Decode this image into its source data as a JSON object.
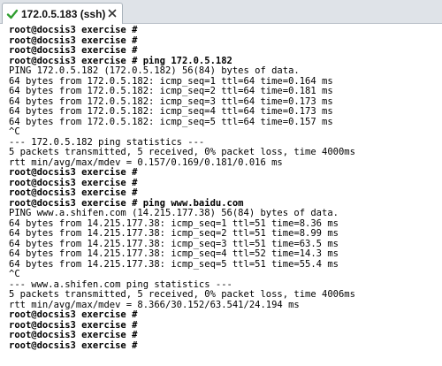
{
  "tab": {
    "title": "172.0.5.183 (ssh)",
    "status_color": "#2f9e2f"
  },
  "terminal": {
    "lines": [
      {
        "type": "prompt",
        "text": "root@docsis3 exercise #"
      },
      {
        "type": "prompt",
        "text": "root@docsis3 exercise #"
      },
      {
        "type": "prompt",
        "text": "root@docsis3 exercise #"
      },
      {
        "type": "prompt",
        "text": "root@docsis3 exercise # ping 172.0.5.182"
      },
      {
        "type": "output",
        "text": "PING 172.0.5.182 (172.0.5.182) 56(84) bytes of data."
      },
      {
        "type": "output",
        "text": "64 bytes from 172.0.5.182: icmp_seq=1 ttl=64 time=0.164 ms"
      },
      {
        "type": "output",
        "text": "64 bytes from 172.0.5.182: icmp_seq=2 ttl=64 time=0.181 ms"
      },
      {
        "type": "output",
        "text": "64 bytes from 172.0.5.182: icmp_seq=3 ttl=64 time=0.173 ms"
      },
      {
        "type": "output",
        "text": "64 bytes from 172.0.5.182: icmp_seq=4 ttl=64 time=0.173 ms"
      },
      {
        "type": "output",
        "text": "64 bytes from 172.0.5.182: icmp_seq=5 ttl=64 time=0.157 ms"
      },
      {
        "type": "output",
        "text": "^C"
      },
      {
        "type": "output",
        "text": "--- 172.0.5.182 ping statistics ---"
      },
      {
        "type": "output",
        "text": "5 packets transmitted, 5 received, 0% packet loss, time 4000ms"
      },
      {
        "type": "output",
        "text": "rtt min/avg/max/mdev = 0.157/0.169/0.181/0.016 ms"
      },
      {
        "type": "prompt",
        "text": "root@docsis3 exercise #"
      },
      {
        "type": "prompt",
        "text": "root@docsis3 exercise #"
      },
      {
        "type": "prompt",
        "text": "root@docsis3 exercise #"
      },
      {
        "type": "prompt",
        "text": "root@docsis3 exercise # ping www.baidu.com"
      },
      {
        "type": "output",
        "text": "PING www.a.shifen.com (14.215.177.38) 56(84) bytes of data."
      },
      {
        "type": "output",
        "text": "64 bytes from 14.215.177.38: icmp_seq=1 ttl=51 time=8.36 ms"
      },
      {
        "type": "output",
        "text": "64 bytes from 14.215.177.38: icmp_seq=2 ttl=51 time=8.99 ms"
      },
      {
        "type": "output",
        "text": "64 bytes from 14.215.177.38: icmp_seq=3 ttl=51 time=63.5 ms"
      },
      {
        "type": "output",
        "text": "64 bytes from 14.215.177.38: icmp_seq=4 ttl=52 time=14.3 ms"
      },
      {
        "type": "output",
        "text": "64 bytes from 14.215.177.38: icmp_seq=5 ttl=51 time=55.4 ms"
      },
      {
        "type": "output",
        "text": "^C"
      },
      {
        "type": "output",
        "text": "--- www.a.shifen.com ping statistics ---"
      },
      {
        "type": "output",
        "text": "5 packets transmitted, 5 received, 0% packet loss, time 4006ms"
      },
      {
        "type": "output",
        "text": "rtt min/avg/max/mdev = 8.366/30.152/63.541/24.194 ms"
      },
      {
        "type": "prompt",
        "text": "root@docsis3 exercise #"
      },
      {
        "type": "prompt",
        "text": "root@docsis3 exercise #"
      },
      {
        "type": "prompt",
        "text": "root@docsis3 exercise #"
      },
      {
        "type": "prompt",
        "text": "root@docsis3 exercise #"
      }
    ]
  }
}
